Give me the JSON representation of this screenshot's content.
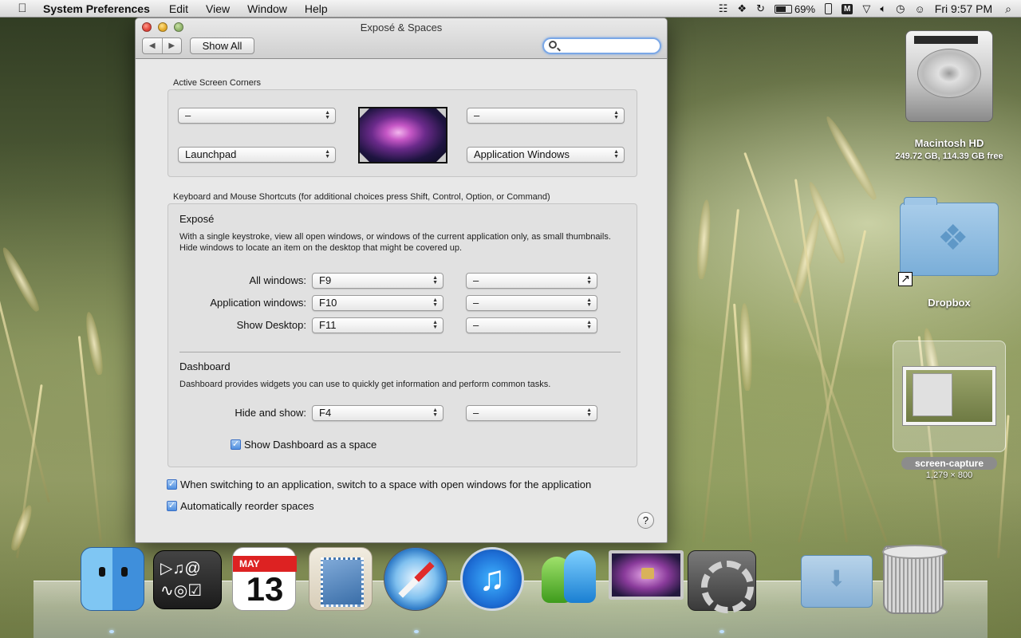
{
  "menubar": {
    "app_name": "System Preferences",
    "menus": [
      "Edit",
      "View",
      "Window",
      "Help"
    ],
    "battery": "69%",
    "clock": "Fri 9:57 PM",
    "status_icons": [
      "wifi-signal-icon",
      "dropbox-icon",
      "sync-icon",
      "battery-icon",
      "phone-icon",
      "m-icon",
      "airport-icon",
      "volume-icon",
      "time-machine-icon",
      "user-icon",
      "spotlight-icon"
    ]
  },
  "window": {
    "title": "Exposé & Spaces",
    "show_all": "Show All",
    "search_placeholder": ""
  },
  "corners": {
    "label": "Active Screen Corners",
    "top_left": "–",
    "top_right": "–",
    "bottom_left": "Launchpad",
    "bottom_right": "Application Windows"
  },
  "shortcuts": {
    "label": "Keyboard and Mouse Shortcuts (for additional choices press Shift, Control, Option, or Command)",
    "expose": {
      "heading": "Exposé",
      "description": "With a single keystroke, view all open windows, or windows of the current application only, as small thumbnails. Hide windows to locate an item on the desktop that might be covered up.",
      "rows": [
        {
          "label": "All windows:",
          "key": "F9",
          "mouse": "–"
        },
        {
          "label": "Application windows:",
          "key": "F10",
          "mouse": "–"
        },
        {
          "label": "Show Desktop:",
          "key": "F11",
          "mouse": "–"
        }
      ]
    },
    "dashboard": {
      "heading": "Dashboard",
      "description": "Dashboard provides widgets you can use to quickly get information and perform common tasks.",
      "hide_show_label": "Hide and show:",
      "hide_show_key": "F4",
      "hide_show_mouse": "–",
      "show_as_space": "Show Dashboard as a space"
    }
  },
  "options": {
    "switch_space": "When switching to an application, switch to a space with open windows for the application",
    "reorder": "Automatically reorder spaces"
  },
  "help": "?",
  "desktop": {
    "hd_name": "Macintosh HD",
    "hd_info": "249.72 GB, 114.39 GB free",
    "dropbox_name": "Dropbox",
    "capture_name": "screen-capture",
    "capture_size": "1,279 × 800"
  },
  "dock": {
    "ical_month": "MAY",
    "ical_day": "13",
    "items": [
      "finder",
      "dashboard",
      "ical",
      "mail",
      "safari",
      "itunes",
      "messenger",
      "screen-lock",
      "system-preferences",
      "downloads",
      "trash"
    ]
  }
}
